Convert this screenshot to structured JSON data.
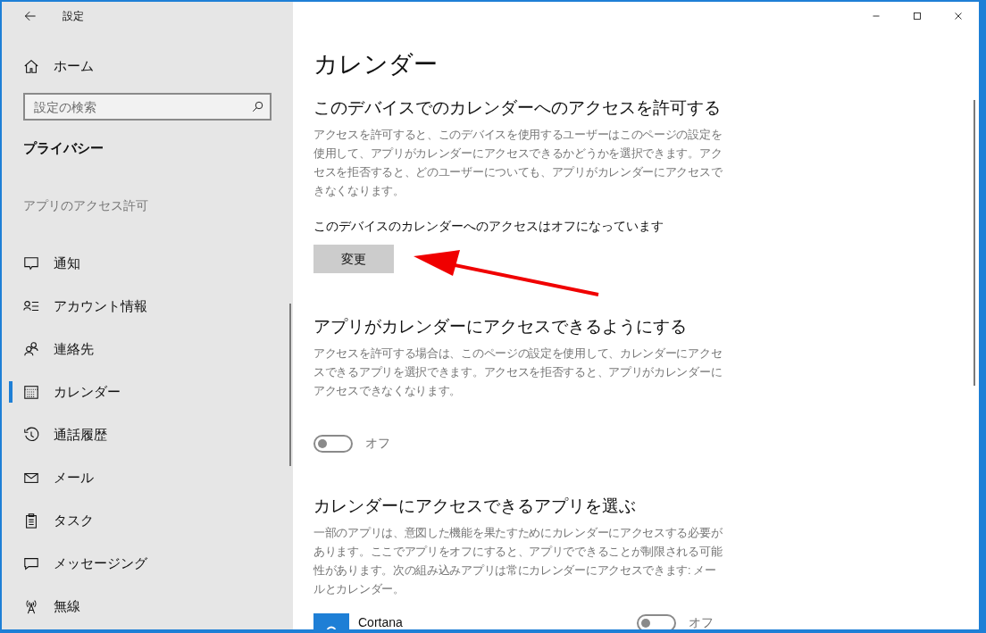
{
  "window": {
    "title": "設定"
  },
  "sidebar": {
    "home": "ホーム",
    "search": {
      "placeholder": "設定の検索"
    },
    "section": "プライバシー",
    "group": "アプリのアクセス許可",
    "items": [
      {
        "kind": "notification",
        "label": "通知",
        "selected": false
      },
      {
        "kind": "account",
        "label": "アカウント情報",
        "selected": false
      },
      {
        "kind": "contacts",
        "label": "連絡先",
        "selected": false
      },
      {
        "kind": "calendar",
        "label": "カレンダー",
        "selected": true
      },
      {
        "kind": "history",
        "label": "通話履歴",
        "selected": false
      },
      {
        "kind": "mail",
        "label": "メール",
        "selected": false
      },
      {
        "kind": "tasks",
        "label": "タスク",
        "selected": false
      },
      {
        "kind": "message",
        "label": "メッセージング",
        "selected": false
      },
      {
        "kind": "radio",
        "label": "無線",
        "selected": false
      }
    ]
  },
  "main": {
    "title": "カレンダー",
    "sections": [
      {
        "heading": "このデバイスでのカレンダーへのアクセスを許可する",
        "body": "アクセスを許可すると、このデバイスを使用するユーザーはこのページの設定を使用して、アプリがカレンダーにアクセスできるかどうかを選択できます。アクセスを拒否すると、どのユーザーについても、アプリがカレンダーにアクセスできなくなります。",
        "status": "このデバイスのカレンダーへのアクセスはオフになっています",
        "button": "変更"
      },
      {
        "heading": "アプリがカレンダーにアクセスできるようにする",
        "body": "アクセスを許可する場合は、このページの設定を使用して、カレンダーにアクセスできるアプリを選択できます。アクセスを拒否すると、アプリがカレンダーにアクセスできなくなります。",
        "toggle": {
          "on": false,
          "label": "オフ"
        }
      },
      {
        "heading": "カレンダーにアクセスできるアプリを選ぶ",
        "body": "一部のアプリは、意図した機能を果たすためにカレンダーにアクセスする必要があります。ここでアプリをオフにすると、アプリでできることが制限される可能性があります。次の組み込みアプリは常にカレンダーにアクセスできます: メールとカレンダー。",
        "apps": [
          {
            "name": "Cortana",
            "on": false,
            "label": "オフ"
          }
        ]
      }
    ]
  }
}
